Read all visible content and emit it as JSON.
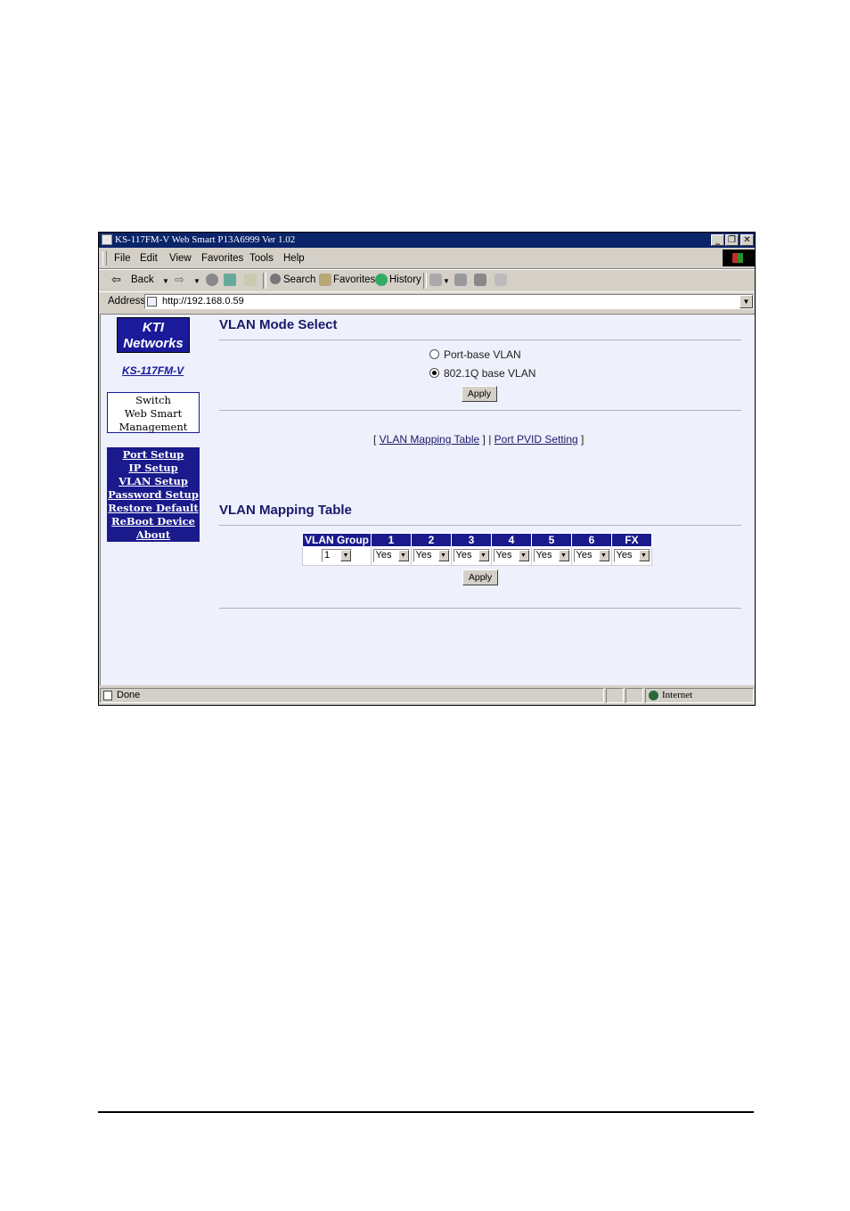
{
  "window": {
    "title": "KS-117FM-V  Web Smart P13A6999 Ver 1.02",
    "controls": {
      "minimize": "_",
      "restore": "❐",
      "close": "✕"
    }
  },
  "menu": [
    "File",
    "Edit",
    "View",
    "Favorites",
    "Tools",
    "Help"
  ],
  "toolbar": {
    "back": "Back",
    "search": "Search",
    "favorites": "Favorites",
    "history": "History"
  },
  "address": {
    "label": "Address",
    "url": "http://192.168.0.59"
  },
  "sidebar": {
    "logo_line1": "KTI",
    "logo_line2": "Networks",
    "model": "KS-117FM-V",
    "box_line1": "Switch",
    "box_line2": "Web Smart",
    "box_line3": "Management",
    "nav": [
      "Port Setup",
      "IP Setup",
      "VLAN Setup",
      "Password Setup",
      "Restore Default",
      "ReBoot Device",
      "About"
    ]
  },
  "mode": {
    "heading": "VLAN Mode Select",
    "option1": "Port-base VLAN",
    "option2": "802.1Q base VLAN",
    "selected": "802.1Q base VLAN",
    "apply": "Apply"
  },
  "links": {
    "open": "[ ",
    "mapping": "VLAN Mapping Table",
    "mid": " ] | ",
    "pvid": "Port PVID Setting",
    "close": " ]"
  },
  "mapping": {
    "heading": "VLAN Mapping Table",
    "columns": [
      "VLAN Group",
      "1",
      "2",
      "3",
      "4",
      "5",
      "6",
      "FX"
    ],
    "group_value": "1",
    "port_values": [
      "Yes",
      "Yes",
      "Yes",
      "Yes",
      "Yes",
      "Yes",
      "Yes"
    ],
    "apply": "Apply"
  },
  "status": {
    "left": "Done",
    "zone": "Internet"
  }
}
